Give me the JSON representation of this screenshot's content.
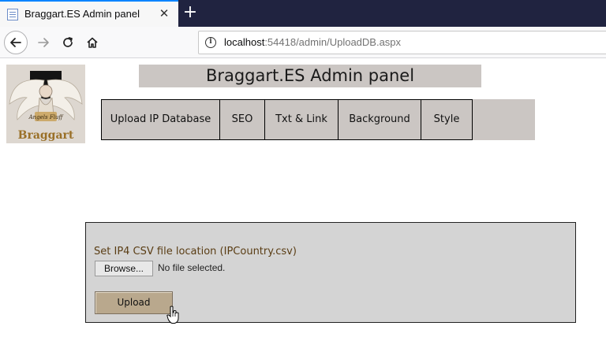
{
  "browser": {
    "tab_title": "Braggart.ES Admin panel",
    "url_host": "localhost",
    "url_rest": ":54418/admin/UploadDB.aspx"
  },
  "header": {
    "title": "Braggart.ES Admin panel",
    "logo_text_top": "Angels Fluff",
    "logo_text_bottom": "Braggart"
  },
  "menu": {
    "items": [
      {
        "label": "Upload IP Database"
      },
      {
        "label": "SEO"
      },
      {
        "label": "Txt & Link"
      },
      {
        "label": "Background"
      },
      {
        "label": "Style"
      }
    ]
  },
  "upload_form": {
    "label": "Set IP4 CSV file location (IPCountry.csv)",
    "browse_label": "Browse...",
    "file_status": "No file selected.",
    "upload_label": "Upload"
  },
  "colors": {
    "tabbar_bg": "#202340",
    "menu_bg": "#cbc6c3",
    "panel_bg": "#d4d4d4",
    "upload_btn_bg": "#b9a88d",
    "label_color": "#5a3d14"
  }
}
